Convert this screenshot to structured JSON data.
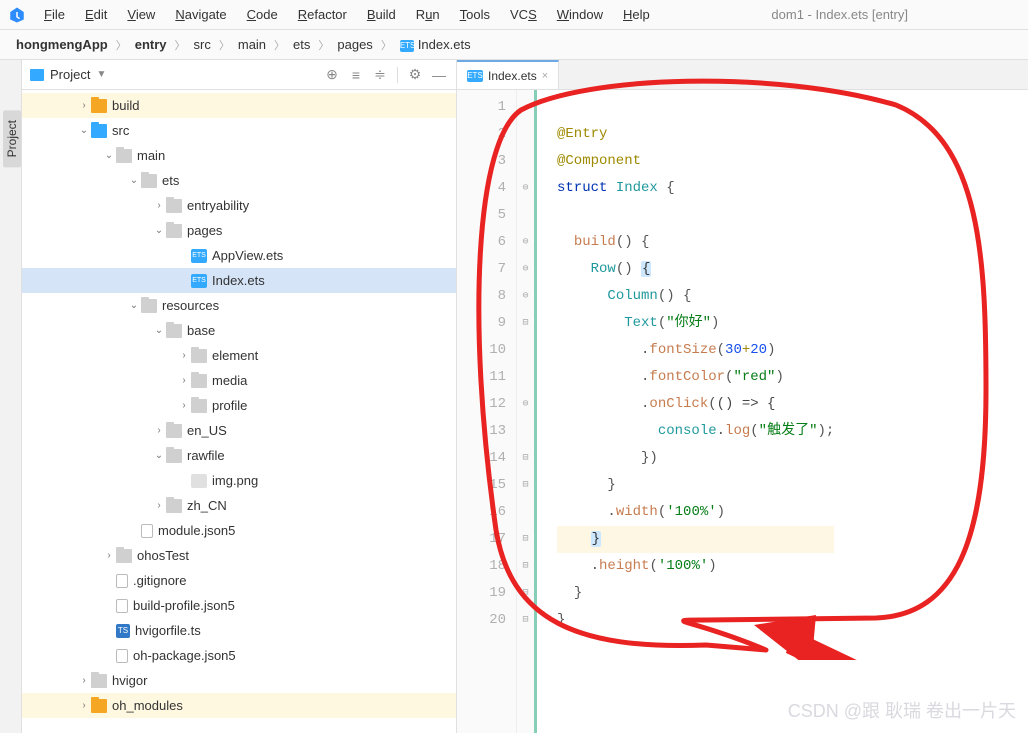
{
  "window_title": "dom1 - Index.ets [entry]",
  "menu": [
    "File",
    "Edit",
    "View",
    "Navigate",
    "Code",
    "Refactor",
    "Build",
    "Run",
    "Tools",
    "VCS",
    "Window",
    "Help"
  ],
  "breadcrumb": {
    "items": [
      "hongmengApp",
      "entry",
      "src",
      "main",
      "ets",
      "pages"
    ],
    "file": "Index.ets"
  },
  "project_panel": {
    "title": "Project",
    "tree": [
      {
        "depth": 0,
        "arrow": "right",
        "icon": "folder orange",
        "label": "build",
        "hl": true
      },
      {
        "depth": 0,
        "arrow": "down",
        "icon": "folder blue",
        "label": "src"
      },
      {
        "depth": 1,
        "arrow": "down",
        "icon": "folder",
        "label": "main"
      },
      {
        "depth": 2,
        "arrow": "down",
        "icon": "folder",
        "label": "ets"
      },
      {
        "depth": 3,
        "arrow": "right",
        "icon": "folder",
        "label": "entryability"
      },
      {
        "depth": 3,
        "arrow": "down",
        "icon": "folder",
        "label": "pages"
      },
      {
        "depth": 4,
        "arrow": "",
        "icon": "ets",
        "label": "AppView.ets",
        "etslabel": "ETS"
      },
      {
        "depth": 4,
        "arrow": "",
        "icon": "ets",
        "label": "Index.ets",
        "etslabel": "ETS",
        "selected": true
      },
      {
        "depth": 2,
        "arrow": "down",
        "icon": "folder",
        "label": "resources"
      },
      {
        "depth": 3,
        "arrow": "down",
        "icon": "folder",
        "label": "base"
      },
      {
        "depth": 4,
        "arrow": "right",
        "icon": "folder",
        "label": "element"
      },
      {
        "depth": 4,
        "arrow": "right",
        "icon": "folder",
        "label": "media"
      },
      {
        "depth": 4,
        "arrow": "right",
        "icon": "folder",
        "label": "profile"
      },
      {
        "depth": 3,
        "arrow": "right",
        "icon": "folder",
        "label": "en_US"
      },
      {
        "depth": 3,
        "arrow": "down",
        "icon": "folder",
        "label": "rawfile"
      },
      {
        "depth": 4,
        "arrow": "",
        "icon": "png",
        "label": "img.png"
      },
      {
        "depth": 3,
        "arrow": "right",
        "icon": "folder",
        "label": "zh_CN"
      },
      {
        "depth": 2,
        "arrow": "",
        "icon": "json5",
        "label": "module.json5"
      },
      {
        "depth": 1,
        "arrow": "right",
        "icon": "folder",
        "label": "ohosTest"
      },
      {
        "depth": 1,
        "arrow": "",
        "icon": "json5",
        "label": ".gitignore"
      },
      {
        "depth": 1,
        "arrow": "",
        "icon": "json5",
        "label": "build-profile.json5"
      },
      {
        "depth": 1,
        "arrow": "",
        "icon": "ts",
        "label": "hvigorfile.ts",
        "etslabel": "TS"
      },
      {
        "depth": 1,
        "arrow": "",
        "icon": "json5",
        "label": "oh-package.json5"
      },
      {
        "depth": 0,
        "arrow": "right",
        "icon": "folder",
        "label": "hvigor"
      },
      {
        "depth": 0,
        "arrow": "right",
        "icon": "folder orange",
        "label": "oh_modules",
        "hl": true
      }
    ]
  },
  "side_tab": "Project",
  "editor": {
    "tab": "Index.ets",
    "code_tokens": {
      "entry": "@Entry",
      "component": "@Component",
      "struct_kw": "struct",
      "struct_name": " Index ",
      "build": "build",
      "row": "Row",
      "column": "Column",
      "text": "Text",
      "text_arg": "\"你好\"",
      "fontsize": "fontSize",
      "fs_a": "30",
      "fs_plus": "+",
      "fs_b": "20",
      "fontcolor": "fontColor",
      "fc_arg": "\"red\"",
      "onclick": "onClick",
      "arrow_fn": "() => {",
      "console": "console",
      "log": "log",
      "log_arg": "\"触发了\"",
      "width": "width",
      "width_arg": "'100%'",
      "height": "height",
      "height_arg": "'100%'"
    },
    "line_numbers": [
      1,
      2,
      3,
      4,
      5,
      6,
      7,
      8,
      9,
      10,
      11,
      12,
      13,
      14,
      15,
      16,
      17,
      18,
      19,
      20
    ]
  },
  "watermark": "CSDN @跟 耿瑞 卷出一片天"
}
